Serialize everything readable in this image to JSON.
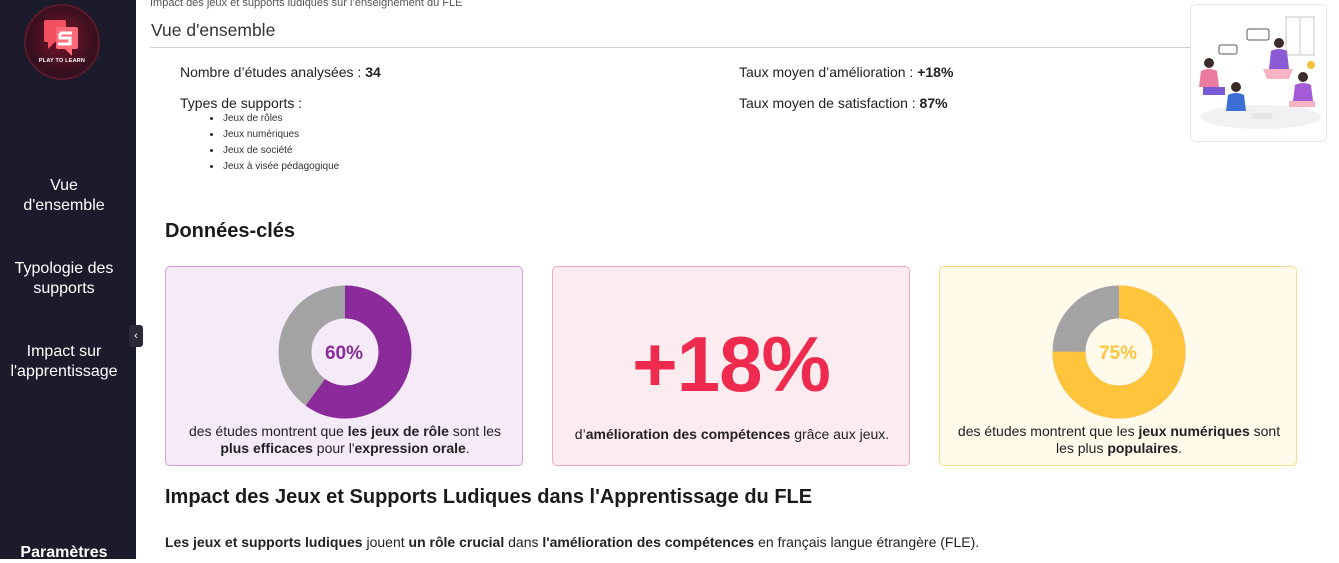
{
  "sidebar": {
    "logo_text": "PLAY TO LEARN",
    "items": [
      {
        "label_line1": "Vue",
        "label_line2": "d'ensemble"
      },
      {
        "label_line1": "Typologie des",
        "label_line2": "supports"
      },
      {
        "label_line1": "Impact sur",
        "label_line2": "l'apprentissage"
      }
    ],
    "settings_label": "Paramètres",
    "collapse_glyph": "‹"
  },
  "breadcrumb": "Impact des jeux et supports ludiques sur l’enseignement du FLE",
  "page_title": "Vue d'ensemble",
  "overview": {
    "studies_label": "Nombre d’études analysées : ",
    "studies_value": "34",
    "types_label": "Types de supports :",
    "types": [
      "Jeux de rôles",
      "Jeux numériques",
      "Jeux de société",
      "Jeux à visée pédagogique"
    ],
    "improvement_label": "Taux moyen d’amélioration : ",
    "improvement_value": "+18%",
    "satisfaction_label": "Taux moyen de satisfaction : ",
    "satisfaction_value": "87%"
  },
  "key_data": {
    "title": "Données-clés",
    "card1": {
      "percent_label": "60%",
      "percent_value": 0.6,
      "color": "#8b2a9b",
      "rest_color": "#a3a3a3",
      "text_1": "des études montrent que ",
      "text_b1": "les jeux de rôle",
      "text_2": " sont les ",
      "text_b2": "plus efficaces",
      "text_3": " pour l'",
      "text_b3": "expression orale",
      "text_4": "."
    },
    "card2": {
      "big_value": "+18%",
      "color": "#ee2b4f",
      "text_1": "d’",
      "text_b1": "amélioration des compétences",
      "text_2": " grâce aux jeux."
    },
    "card3": {
      "percent_label": "75%",
      "percent_value": 0.75,
      "color": "#fec43c",
      "rest_color": "#a3a3a3",
      "text_1": "des études montrent que les ",
      "text_b1": "jeux numériques",
      "text_2": " sont les plus ",
      "text_b2": "populaires",
      "text_3": "."
    }
  },
  "impact": {
    "title": "Impact des Jeux et Supports Ludiques dans l'Apprentissage du FLE",
    "b1": "Les jeux et supports ludiques",
    "t1": " jouent ",
    "b2": "un rôle crucial",
    "t2": " dans ",
    "b3": "l'amélioration des compétences",
    "t3": " en français langue étrangère (FLE)."
  }
}
